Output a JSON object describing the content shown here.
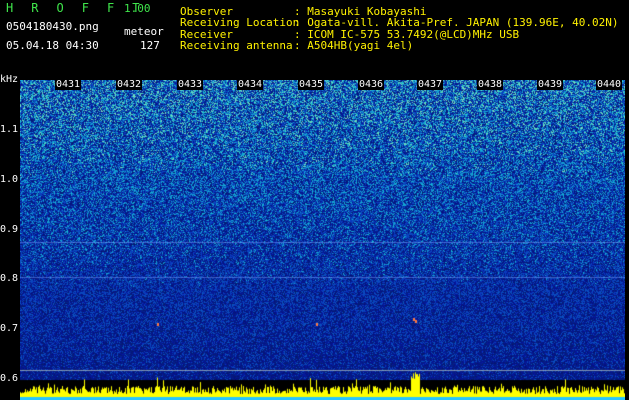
{
  "header": {
    "app_name": "H R O F F T",
    "version": "1.00",
    "filename": "0504180430.png",
    "mode_label": "meteor",
    "datetime": "05.04.18 04:30",
    "count": "127"
  },
  "info": [
    {
      "label": "Observer",
      "value": ": Masayuki Kobayashi"
    },
    {
      "label": "Receiving Location",
      "value": ": Ogata-vill. Akita-Pref. JAPAN (139.96E, 40.02N)"
    },
    {
      "label": "Receiver",
      "value": ": ICOM IC-575 53.7492(@LCD)MHz USB"
    },
    {
      "label": "Receiving antenna",
      "value": ": A504HB(yagi 4el)"
    }
  ],
  "spectrogram": {
    "freq_unit": "kHz",
    "freq_ticks": [
      "1.1",
      "1.0",
      "0.9",
      "0.8",
      "0.7",
      "0.6"
    ],
    "time_ticks": [
      "0431",
      "0432",
      "0433",
      "0434",
      "0435",
      "0436",
      "0437",
      "0438",
      "0439",
      "0440"
    ],
    "colors": {
      "background": "#000000",
      "noise_low": "#0a1a8a",
      "noise_high": "#2fe0c0",
      "trace": "#ffff00"
    }
  }
}
